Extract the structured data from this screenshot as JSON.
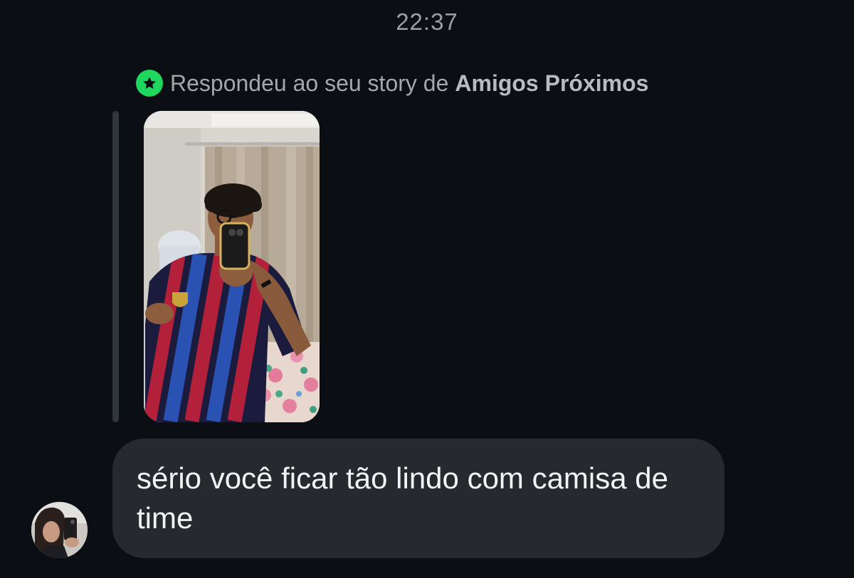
{
  "header": {
    "time": "22:37"
  },
  "story_reply": {
    "prefix": "Respondeu ao seu story de",
    "audience": "Amigos Próximos",
    "badge_icon": "star-icon",
    "badge_color": "#1fd65f"
  },
  "message": {
    "text": "sério você ficar tão lindo com camisa de time",
    "bubble_color": "#26292e"
  },
  "colors": {
    "background": "#0b0f14",
    "secondary_text": "#a3a8ae"
  }
}
